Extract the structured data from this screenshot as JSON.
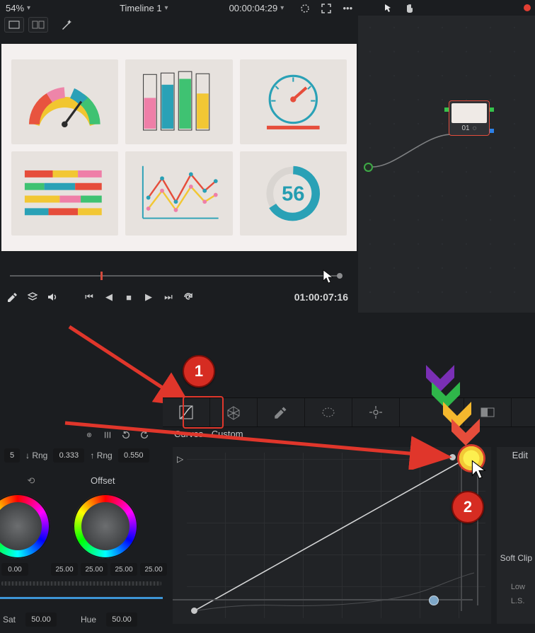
{
  "topbar": {
    "zoom": "54%",
    "timeline": "Timeline 1",
    "timecode": "00:00:04:29"
  },
  "node": {
    "label": "01",
    "glyph": "◌"
  },
  "transport": {
    "duration": "01:00:07:16"
  },
  "annotations": {
    "step1": "1",
    "step2": "2"
  },
  "curves": {
    "title": "Curves - Custom",
    "edit_label": "Edit",
    "softclip": "Soft Clip",
    "low": "Low",
    "ls": "L.S."
  },
  "params": {
    "box1": "5",
    "rng_down_label": "↓ Rng",
    "rng_down": "0.333",
    "rng_up_label": "↑ Rng",
    "rng_up": "0.550",
    "offset_label": "Offset",
    "single": "0.00",
    "quad": [
      "25.00",
      "25.00",
      "25.00",
      "25.00"
    ],
    "sat_label": "Sat",
    "sat": "50.00",
    "hue_label": "Hue",
    "hue": "50.00"
  },
  "preview": {
    "donut_value": "56"
  }
}
